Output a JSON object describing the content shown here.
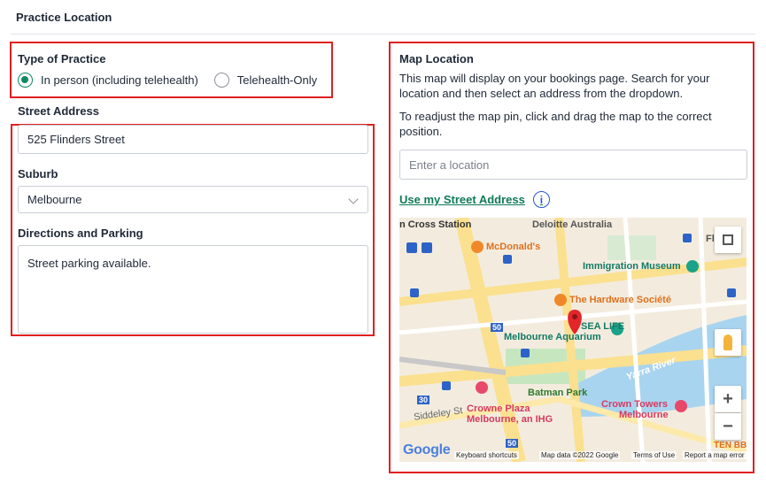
{
  "section": {
    "title": "Practice Location"
  },
  "practice_type": {
    "label": "Type of Practice",
    "options": [
      {
        "label": "In person (including telehealth)",
        "checked": true
      },
      {
        "label": "Telehealth-Only",
        "checked": false
      }
    ]
  },
  "address": {
    "street_label": "Street Address",
    "street_value": "525 Flinders Street",
    "suburb_label": "Suburb",
    "suburb_value": "Melbourne",
    "directions_label": "Directions and Parking",
    "directions_value": "Street parking available."
  },
  "map_location": {
    "label": "Map Location",
    "help_1": "This map will display on your bookings page. Search for your location and then select an address from the dropdown.",
    "help_2": "To readjust the map pin, click and drag the map to the correct position.",
    "search_placeholder": "Enter a location",
    "use_address_link": "Use my Street Address",
    "info_glyph": "i"
  },
  "map": {
    "labels": {
      "cross_station": "n Cross Station",
      "deloitte": "Deloitte Australia",
      "mcdonalds": "McDonald's",
      "immigration_museum": "Immigration Museum",
      "hardware_societe": "The Hardware Société",
      "sea_life": "SEA LIFE",
      "melbourne_aquarium": "Melbourne Aquarium",
      "yarra_river": "Yarra River",
      "batman_park": "Batman Park",
      "crown_plaza": "Crowne Plaza",
      "crown_plaza_2": "Melbourne, an IHG",
      "crown_towers": "Crown Towers",
      "crown_towers_2": "Melbourne",
      "siddeley": "Siddeley St",
      "ten_bbq": "TEN BBQ",
      "fl": "Fl"
    },
    "route_numbers": {
      "r50a": "50",
      "r50b": "50",
      "r30": "30"
    },
    "google": "Google",
    "attributions": {
      "shortcuts": "Keyboard shortcuts",
      "data": "Map data ©2022 Google",
      "terms": "Terms of Use",
      "report": "Report a map error"
    },
    "controls": {
      "zoom_in": "+",
      "zoom_out": "−"
    },
    "colors": {
      "water": "#a8d4f0",
      "road": "#fbe08f",
      "park": "#c6e6c0",
      "pin": "#e3262a"
    }
  }
}
